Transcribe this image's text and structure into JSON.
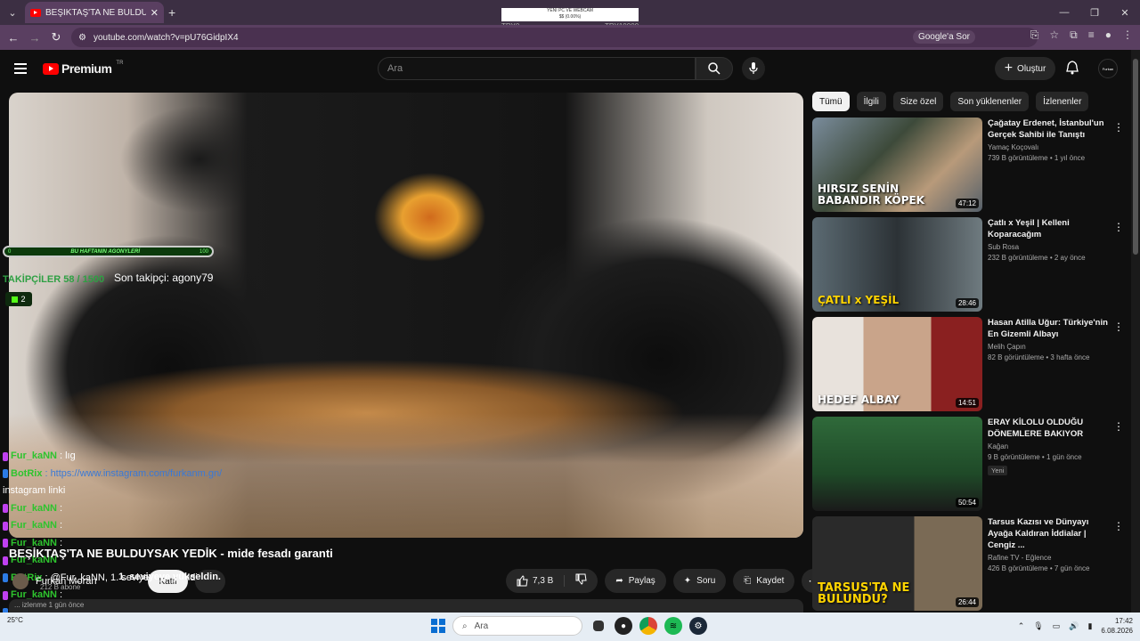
{
  "browser": {
    "tab_title": "BEŞİKTAŞ'TA NE BULDUYSAK YE",
    "url": "youtube.com/watch?v=pU76GidpIX4",
    "google_ask": "Google'a Sor"
  },
  "stream_overlay": {
    "top_title": "YENİ PC VE WEBCAM",
    "top_progress": "$$ (0.00%)",
    "left_label": "TRY0",
    "right_label": "TRY10000",
    "bar_left": "0",
    "bar_mid": "BU HAFTANIN AGONYLERİ",
    "bar_right": "100",
    "followers": "TAKİPÇİLER 58 / 1500",
    "last_follower": "Son takipçi: agony79",
    "kick_count": "2"
  },
  "chat": [
    {
      "user": "Fur_kaNN",
      "text": ": lıg",
      "type": "user"
    },
    {
      "user": "BotRix",
      "text": ": https://www.instagram.com/furkanm.gn/",
      "type": "bot"
    },
    {
      "user": "",
      "text": "instagram linki",
      "type": "plain"
    },
    {
      "user": "Fur_kaNN",
      "text": ":",
      "type": "user"
    },
    {
      "user": "Fur_kaNN",
      "text": ":",
      "type": "user"
    },
    {
      "user": "Fur_kaNN",
      "text": ":",
      "type": "user"
    },
    {
      "user": "Fur_kaNN",
      "text": "",
      "type": "user"
    },
    {
      "user": "BotRix",
      "text": ": @Fur_kaNN, 1. seviyeye yükseldin.",
      "type": "bot"
    },
    {
      "user": "Fur_kaNN",
      "text": ":",
      "type": "user"
    },
    {
      "user": "BotRix",
      "text": ": ...",
      "type": "bot"
    },
    {
      "user": "Fur_kaNN",
      "text": "",
      "type": "user"
    }
  ],
  "youtube": {
    "search_placeholder": "Ara",
    "premium": "Premium",
    "tr": "TR",
    "create": "Oluştur",
    "avatar_text": "Furkan",
    "video_title": "BEŞİKTAŞ'TA NE BULDUYSAK YEDİK - mide fesadı garanti",
    "channel": "Furkan Moran",
    "subscribers": "212 B abone",
    "subscribe": "Katıl",
    "likes": "7,3 B",
    "share": "Paylaş",
    "ask": "Soru",
    "save": "Kaydet",
    "desc_meta": "... izlenme  1 gün önce"
  },
  "chips": [
    "Tümü",
    "İlgili",
    "Size özel",
    "Son yüklenenler",
    "İzlenenler"
  ],
  "recommendations": [
    {
      "title": "Çağatay Erdenet, İstanbul'un Gerçek Sahibi ile Tanıştı",
      "channel": "Yamaç Koçovalı",
      "meta": "739 B görüntüleme • 1 yıl önce",
      "duration": "47:12",
      "thumb_text": "HIRSIZ SENİN BABANDIR KÖPEK",
      "new": ""
    },
    {
      "title": "Çatlı x Yeşil | Kelleni Koparacağım",
      "channel": "Sub Rosa",
      "meta": "232 B görüntüleme • 2 ay önce",
      "duration": "28:46",
      "thumb_text": "ÇATLI x YEŞİL",
      "new": ""
    },
    {
      "title": "Hasan Atilla Uğur: Türkiye'nin En Gizemli Albayı",
      "channel": "Melih Çapın",
      "meta": "82 B görüntüleme • 3 hafta önce",
      "duration": "14:51",
      "thumb_text": "HEDEF ALBAY",
      "new": ""
    },
    {
      "title": "ERAY KİLOLU OLDUĞU DÖNEMLERE BAKIYOR",
      "channel": "Kağan",
      "meta": "9 B görüntüleme • 1 gün önce",
      "duration": "50:54",
      "thumb_text": "",
      "new": "Yeni"
    },
    {
      "title": "Tarsus Kazısı ve Dünyayı Ayağa Kaldıran İddialar | Cengiz ...",
      "channel": "Rafine TV - Eğlence",
      "meta": "426 B görüntüleme • 7 gün önce",
      "duration": "26:44",
      "thumb_text": "TARSUS'TA NE BULUNDU?",
      "new": ""
    }
  ],
  "taskbar": {
    "temp": "25°C",
    "weather": "",
    "search": "Ara",
    "time": "17:42",
    "date": "6.08.2026"
  }
}
